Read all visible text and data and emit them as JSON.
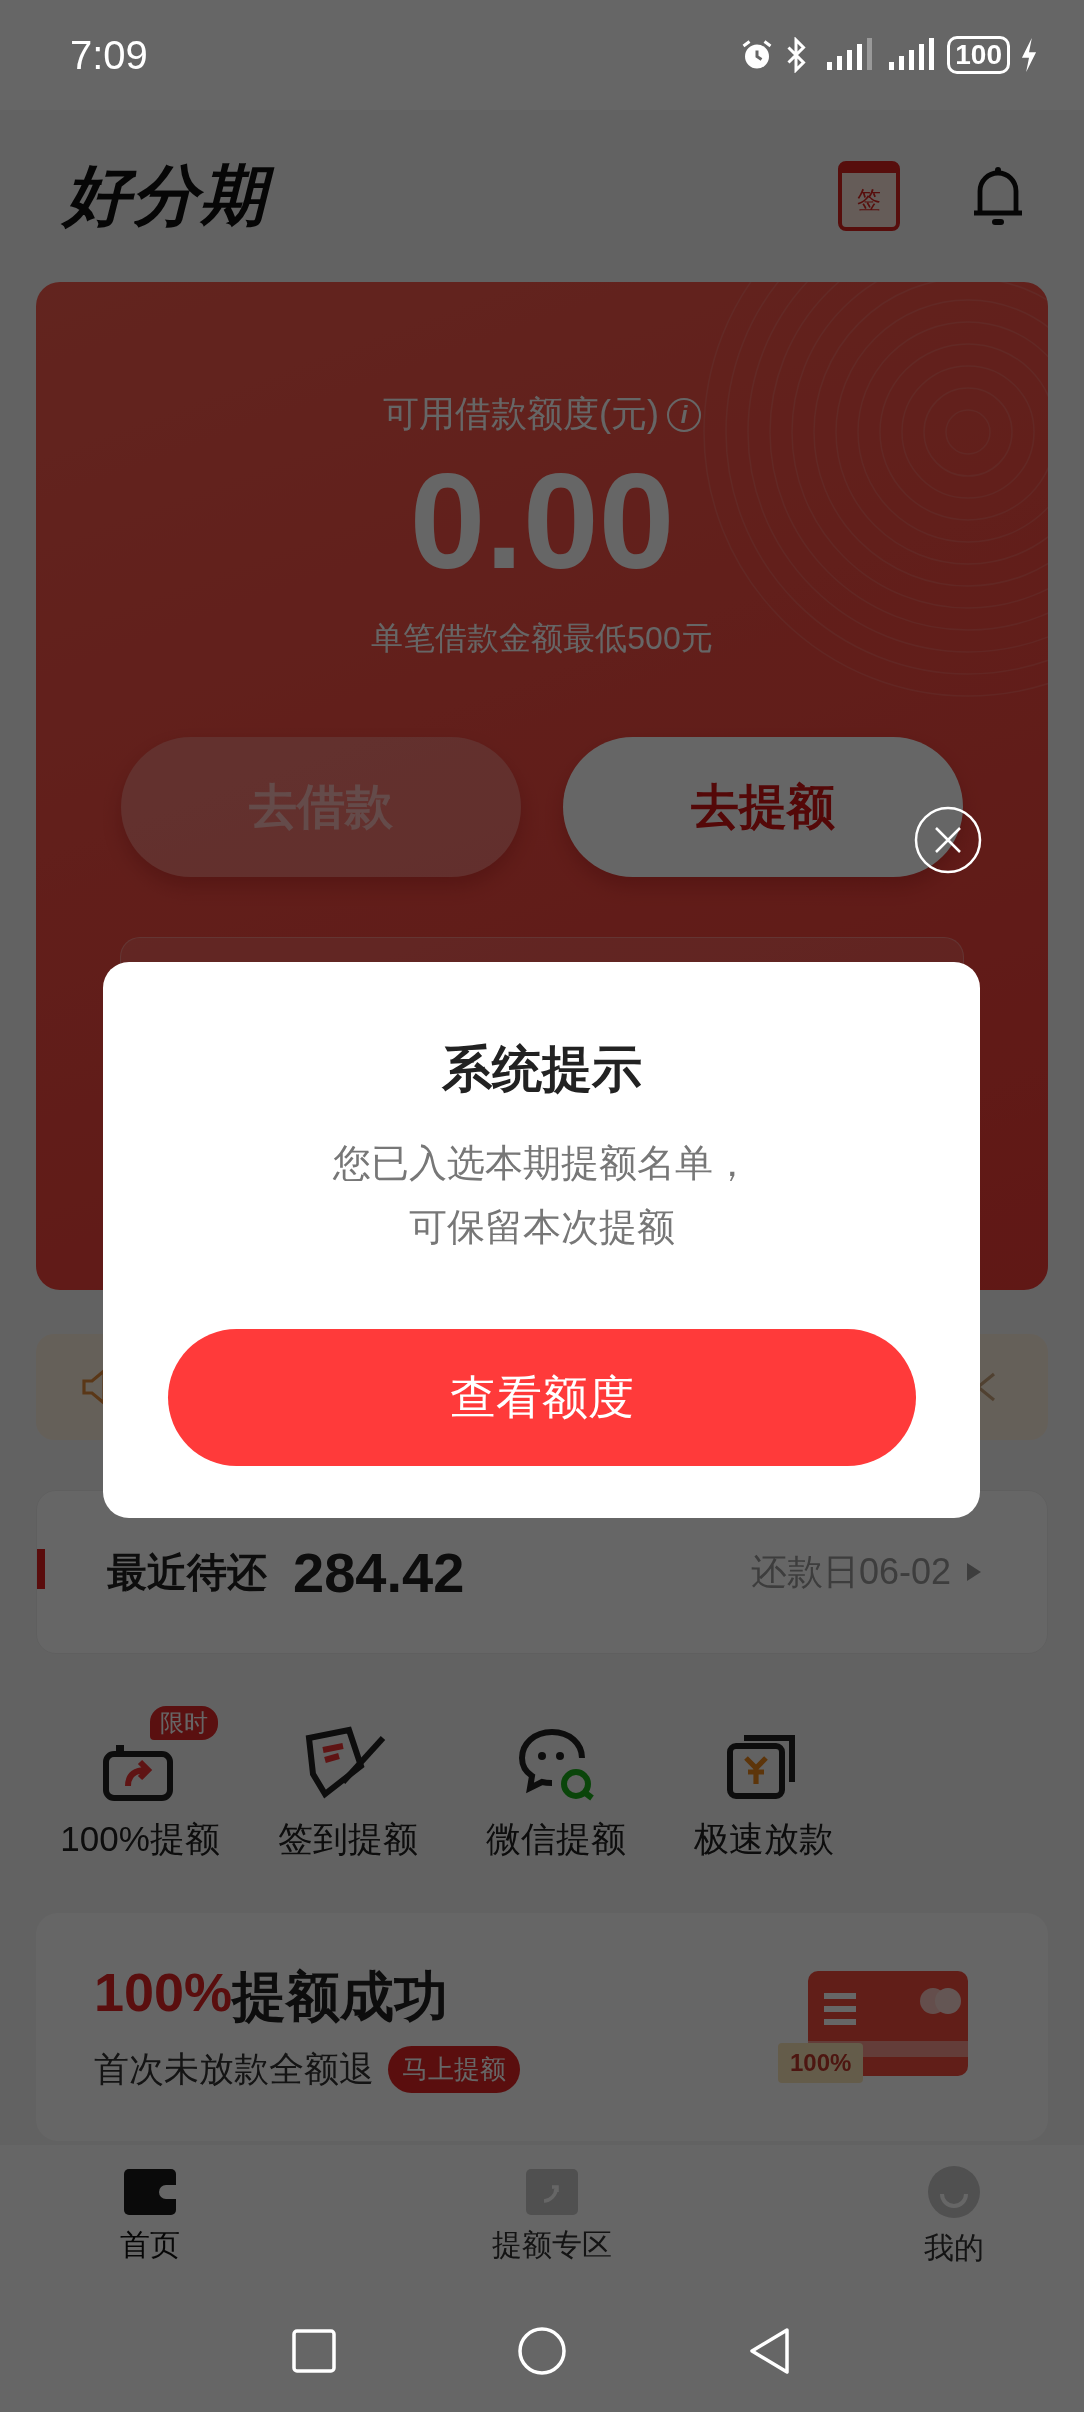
{
  "status_bar": {
    "time": "7:09",
    "battery": "100"
  },
  "header": {
    "logo": "好分期",
    "sign_label": "签"
  },
  "credit_card": {
    "label": "可用借款额度(元)",
    "info": "i",
    "amount": "0.00",
    "note": "单笔借款金额最低500元",
    "buttons": [
      {
        "label": "去借款",
        "disabled": true
      },
      {
        "label": "去提额",
        "disabled": false
      }
    ]
  },
  "repay": {
    "label": "最近待还",
    "amount": "284.42",
    "due": "还款日06-02"
  },
  "quick_actions": [
    {
      "kind": "boost",
      "label": "100%提额",
      "badge": "限时"
    },
    {
      "kind": "checkin",
      "label": "签到提额"
    },
    {
      "kind": "wechat",
      "label": "微信提额"
    },
    {
      "kind": "fast",
      "label": "极速放款"
    }
  ],
  "promo": {
    "title_highlight": "100%",
    "title": "提额成功",
    "subtitle": "首次未放款全额退",
    "tag": "马上提额",
    "ticket": "100%"
  },
  "bottom_nav": [
    {
      "kind": "home",
      "label": "首页",
      "selected": true
    },
    {
      "kind": "boost",
      "label": "提额专区",
      "selected": false
    },
    {
      "kind": "me",
      "label": "我的",
      "selected": false
    }
  ],
  "dialog": {
    "title": "系统提示",
    "message": [
      "您已入选本期提额名单，",
      "可保留本次提额"
    ],
    "button": "查看额度"
  }
}
